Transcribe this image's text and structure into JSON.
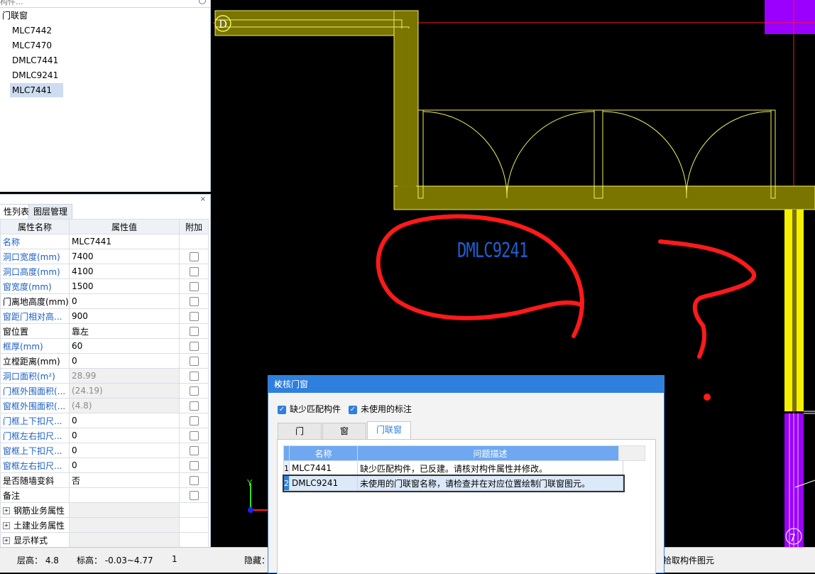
{
  "tree": {
    "search_placeholder": "构件...",
    "group_label": "门联窗",
    "items": [
      "MLC7442",
      "MLC7470",
      "DMLC7441",
      "DMLC9241",
      "MLC7441"
    ],
    "selected_index": 4
  },
  "properties_panel": {
    "close_glyph": "×",
    "tabs": [
      "性列表",
      "图层管理"
    ],
    "headers": [
      "属性名称",
      "属性值",
      "附加"
    ],
    "rows": [
      {
        "name": "名称",
        "value": "MLC7441",
        "style": "blue",
        "checkbox": false
      },
      {
        "name": "洞口宽度(mm)",
        "value": "7400",
        "style": "blue",
        "checkbox": true
      },
      {
        "name": "洞口高度(mm)",
        "value": "4100",
        "style": "blue",
        "checkbox": true
      },
      {
        "name": "窗宽度(mm)",
        "value": "1500",
        "style": "blue",
        "checkbox": true
      },
      {
        "name": "门离地高度(mm)",
        "value": "0",
        "style": "black",
        "checkbox": true
      },
      {
        "name": "窗距门相对高...",
        "value": "900",
        "style": "blue",
        "checkbox": true
      },
      {
        "name": "窗位置",
        "value": "靠左",
        "style": "black",
        "checkbox": true
      },
      {
        "name": "框厚(mm)",
        "value": "60",
        "style": "blue",
        "checkbox": true
      },
      {
        "name": "立樘距离(mm)",
        "value": "0",
        "style": "black",
        "checkbox": true
      },
      {
        "name": "洞口面积(m²)",
        "value": "28.99",
        "style": "blue-gray",
        "checkbox": true
      },
      {
        "name": "门框外围面积(...",
        "value": "(24.19)",
        "style": "blue-gray",
        "checkbox": true
      },
      {
        "name": "窗框外围面积(...",
        "value": "(4.8)",
        "style": "blue-gray",
        "checkbox": true
      },
      {
        "name": "门框上下扣尺...",
        "value": "0",
        "style": "blue",
        "checkbox": true
      },
      {
        "name": "门框左右扣尺...",
        "value": "0",
        "style": "blue",
        "checkbox": true
      },
      {
        "name": "窗框上下扣尺...",
        "value": "0",
        "style": "blue",
        "checkbox": true
      },
      {
        "name": "窗框左右扣尺...",
        "value": "0",
        "style": "blue",
        "checkbox": true
      },
      {
        "name": "是否随墙变斜",
        "value": "否",
        "style": "black",
        "checkbox": true
      },
      {
        "name": "备注",
        "value": "",
        "style": "black",
        "checkbox": true
      }
    ],
    "groups": [
      "钢筋业务属性",
      "土建业务属性",
      "显示样式"
    ]
  },
  "canvas": {
    "axis_label": "D",
    "grid_number": "7",
    "annotation_text": "DMLC9241",
    "colors": {
      "wall": "#7a7400",
      "wall_line": "#f0f060",
      "column": "#a000ff",
      "annotation_red": "#ff1a1a",
      "text_blue": "#1f5fd0",
      "yellow_post": "#f5f000"
    }
  },
  "dialog": {
    "title": "校核门窗",
    "close_glyph": "×",
    "checks": [
      {
        "label": "缺少匹配构件",
        "checked": true
      },
      {
        "label": "未使用的标注",
        "checked": true
      }
    ],
    "tabs": [
      "门",
      "窗",
      "门联窗"
    ],
    "active_tab": 2,
    "columns": [
      "名称",
      "问题描述"
    ],
    "rows": [
      {
        "index": "1",
        "name": "MLC7441",
        "desc": "缺少匹配构件，已反建。请核对构件属性并修改。"
      },
      {
        "index": "2",
        "name": "DMLC9241",
        "desc": "未使用的门联窗名称，请检查并在对应位置绘制门联窗图元。"
      }
    ],
    "selected_row": 1
  },
  "statusbar": {
    "floor_height": "层高：  4.8",
    "elevation": "标高：  -0.03~4.77",
    "count": "1",
    "hidden": "隐藏：",
    "hint": "拾取构件图元"
  }
}
